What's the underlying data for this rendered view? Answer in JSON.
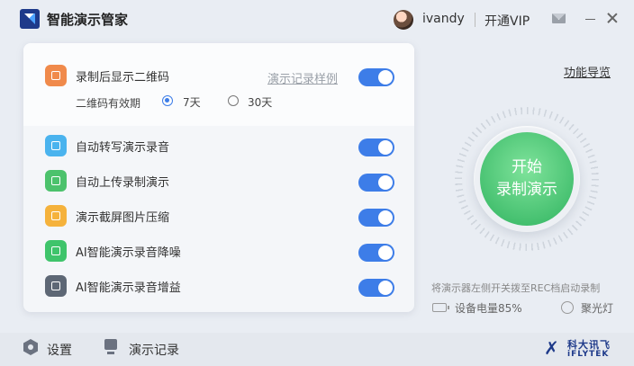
{
  "app": {
    "title": "智能演示管家"
  },
  "header": {
    "username": "ivandy",
    "vip_label": "开通VIP"
  },
  "qr_section": {
    "label": "录制后显示二维码",
    "sample_link": "演示记录样例",
    "enabled": true,
    "validity_label": "二维码有效期",
    "options": [
      {
        "label": "7天",
        "selected": true
      },
      {
        "label": "30天",
        "selected": false
      }
    ]
  },
  "features": [
    {
      "label": "自动转写演示录音",
      "icon": "transcribe-icon",
      "color": "#4ab3ee",
      "enabled": true
    },
    {
      "label": "自动上传录制演示",
      "icon": "upload-icon",
      "color": "#4cc26c",
      "enabled": true
    },
    {
      "label": "演示截屏图片压缩",
      "icon": "image-compress-icon",
      "color": "#f5b23c",
      "enabled": true
    },
    {
      "label": "AI智能演示录音降噪",
      "icon": "noise-reduction-icon",
      "color": "#3fc46b",
      "enabled": true
    },
    {
      "label": "AI智能演示录音增益",
      "icon": "gain-sliders-icon",
      "color": "#5d6775",
      "enabled": true
    }
  ],
  "qr_icon_color": "#f08a4b",
  "right": {
    "guide_link": "功能导览",
    "start_line1": "开始",
    "start_line2": "录制演示",
    "hint": "将演示器左侧开关拨至REC档启动录制",
    "battery_label": "设备电量85%",
    "spotlight_label": "聚光灯"
  },
  "bottom": {
    "settings_label": "设置",
    "records_label": "演示记录",
    "brand_cn": "科大讯飞",
    "brand_en": "iFLYTEK"
  },
  "colors": {
    "accent": "#3d7de8",
    "start_green": "#3fc46b"
  }
}
